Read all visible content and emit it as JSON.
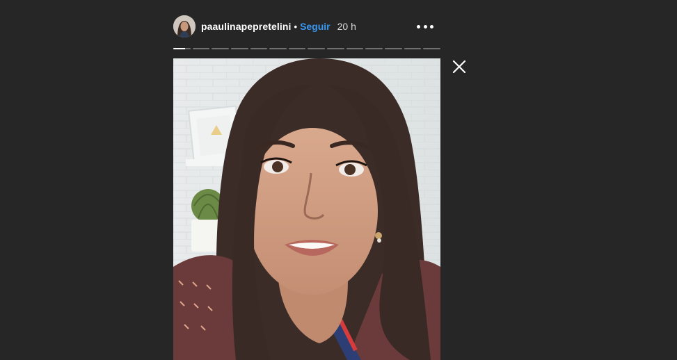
{
  "story": {
    "username": "paaulinapepretelini",
    "separator": "•",
    "follow_label": "Seguir",
    "timestamp": "20 h",
    "segment_count": 14,
    "active_segment_index": 0,
    "active_segment_progress": 0.7,
    "accent_color": "#3897f0",
    "background_color": "#262626"
  },
  "icons": {
    "more": "more-options-icon",
    "close": "close-icon"
  }
}
